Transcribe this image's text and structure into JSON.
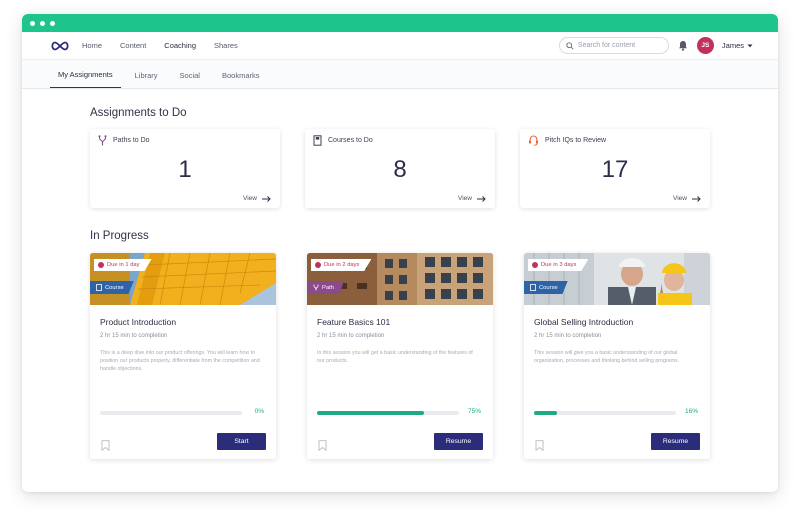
{
  "colors": {
    "brand_green": "#1dc48c",
    "primary": "#2b2d7a",
    "due_red": "#c0325b",
    "progress": "#1eaa82",
    "course_tag": "#2e63a8",
    "path_tag": "#8a4a8c"
  },
  "nav": {
    "links": [
      "Home",
      "Content",
      "Coaching",
      "Shares"
    ],
    "search_placeholder": "Search for content",
    "avatar_initials": "JS",
    "username": "James"
  },
  "subnav": {
    "tabs": [
      "My Assignments",
      "Library",
      "Social",
      "Bookmarks"
    ]
  },
  "assignments": {
    "title": "Assignments to Do",
    "cards": [
      {
        "label": "Paths to Do",
        "count": "1",
        "view": "View",
        "icon": "path-fork-icon"
      },
      {
        "label": "Courses to Do",
        "count": "8",
        "view": "View",
        "icon": "book-icon"
      },
      {
        "label": "Pitch IQs to Review",
        "count": "17",
        "view": "View",
        "icon": "headset-icon"
      }
    ]
  },
  "in_progress": {
    "title": "In Progress",
    "cards": [
      {
        "due": "Due in 1 day",
        "kind": "Course",
        "title": "Product Introduction",
        "duration": "2 hr 15 min to completion",
        "description": "This is a deep dive into our product offerings. You will learn how to position our products properly, differentiate from the competition and handle objections.",
        "progress_label": "0%",
        "progress": 0,
        "action": "Start"
      },
      {
        "due": "Due in 2 days",
        "kind": "Path",
        "title": "Feature Basics 101",
        "duration": "2 hr 15 min to completion",
        "description": "In this session you will get a basic understanding of the features of our products.",
        "progress_label": "75%",
        "progress": 0.75,
        "action": "Resume"
      },
      {
        "due": "Due in 3 days",
        "kind": "Course",
        "title": "Global Selling Introduction",
        "duration": "2 hr 15 min to completion",
        "description": "This session will give you a basic understanding of our global organization, processes and thinking behind selling programs.",
        "progress_label": "16%",
        "progress": 0.16,
        "action": "Resume"
      }
    ]
  }
}
